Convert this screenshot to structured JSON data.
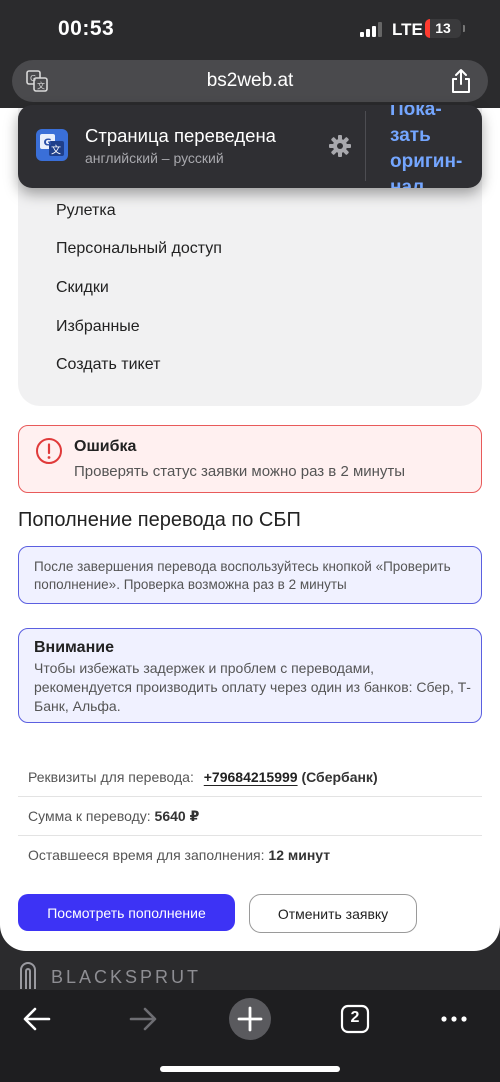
{
  "status": {
    "time": "00:53",
    "network": "LTE",
    "battery": "13",
    "battery_level": 0.13
  },
  "browser": {
    "url": "bs2web.at"
  },
  "translation": {
    "title": "Страница переведена",
    "languages": "английский – русский",
    "show_original": "Пока-\nзать\nоригин-\nнал"
  },
  "menu": {
    "items": [
      {
        "label": "Рулетка"
      },
      {
        "label": "Персональный доступ"
      },
      {
        "label": "Скидки"
      },
      {
        "label": "Избранные"
      },
      {
        "label": "Создать тикет"
      }
    ]
  },
  "error": {
    "title": "Ошибка",
    "text": "Проверять статус заявки можно раз в 2 минуты"
  },
  "section": {
    "title": "Пополнение перевода по СБП"
  },
  "info": {
    "text": "После завершения перевода воспользуйтесь кнопкой «Проверить пополнение». Проверка возможна раз в 2 минуты"
  },
  "warning": {
    "title": "Внимание",
    "text": "Чтобы избежать задержек и проблем с переводами, рекомендуется производить оплату через один из банков: Сбер, Т-Банк, Альфа."
  },
  "details": {
    "requisites_label": "Реквизиты для перевода:",
    "phone": "+79684215999",
    "bank": "(Сбербанк)",
    "amount_label": "Сумма к переводу:",
    "amount": "5640 ₽",
    "time_label": "Оставшееся время для заполнения:",
    "time_value": "12 минут"
  },
  "buttons": {
    "check": "Посмотреть пополнение",
    "cancel": "Отменить заявку"
  },
  "brand": {
    "name": "BLACKSPRUT"
  },
  "toolbar": {
    "tabs_count": "2"
  },
  "colors": {
    "primary": "#3d33f5",
    "error": "#e85a5a",
    "info_border": "#5b5fe0",
    "link_blue": "#74a6ff"
  }
}
